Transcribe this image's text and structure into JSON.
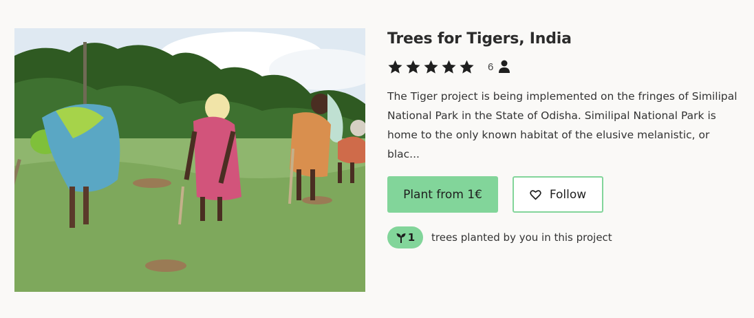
{
  "project": {
    "title": "Trees for Tigers, India",
    "rating_count": "6",
    "description": "The Tiger project is being implemented on the fringes of Similipal National Park in the State of Odisha. Similipal National Park is home to the only known habitat of the elusive melanistic, or blac...",
    "image_alt": "Women planting trees in a grassy field"
  },
  "rating": {
    "stars": 5,
    "max": 5
  },
  "actions": {
    "plant_label": "Plant from 1€",
    "follow_label": "Follow"
  },
  "planted": {
    "count": "1",
    "text": "trees planted by you in this project"
  },
  "icons": {
    "star": "star-icon",
    "person": "person-icon",
    "heart": "heart-icon",
    "sprout": "sprout-icon"
  },
  "colors": {
    "accent": "#82d59a",
    "background": "#faf9f7",
    "text": "#2b2b2b"
  }
}
